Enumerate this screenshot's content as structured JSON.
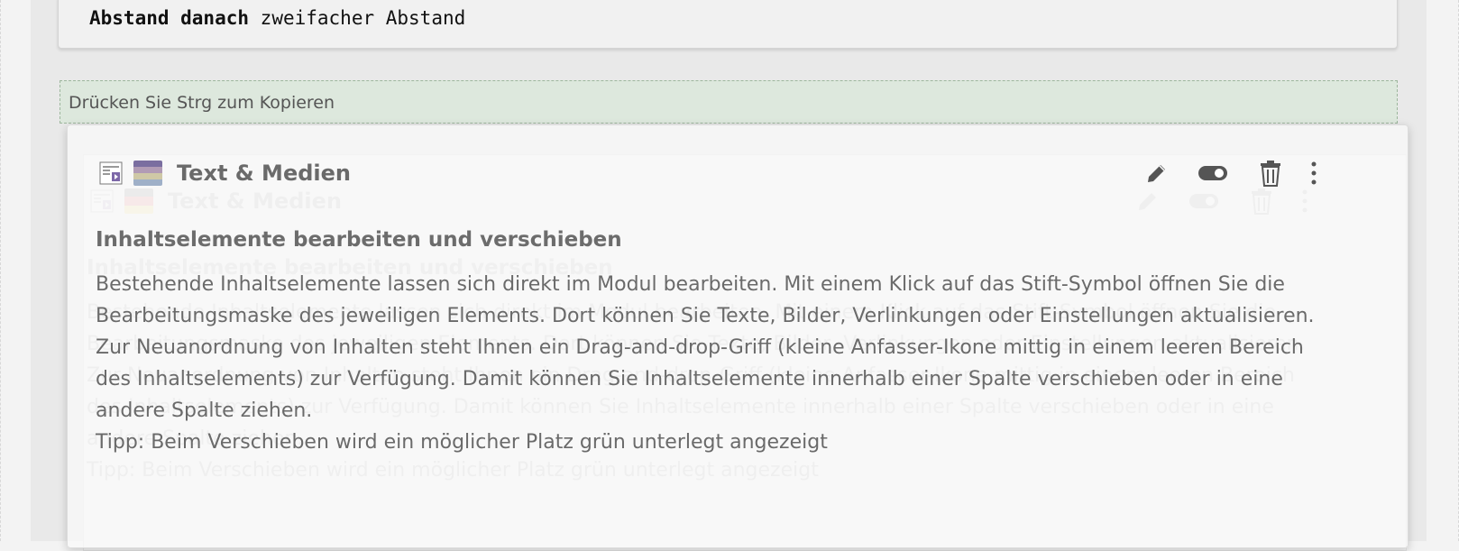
{
  "previous_element": {
    "label": "Abstand danach",
    "value": "zweifacher Abstand"
  },
  "dropzone": {
    "hint": "Drücken Sie Strg zum Kopieren"
  },
  "content_element": {
    "type_icon": "text-media-icon",
    "language_icon": "language-flag-icon",
    "title": "Text & Medien",
    "actions": [
      "pencil-icon",
      "toggle-icon",
      "trash-icon",
      "more-vertical-icon"
    ],
    "heading": "Inhaltselemente bearbeiten und verschieben",
    "paragraphs": [
      "Bestehende Inhaltselemente lassen sich direkt im Modul bearbeiten. Mit einem Klick auf das Stift-Symbol öffnen Sie die Bearbeitungsmaske des jeweiligen Elements. Dort können Sie Texte, Bilder, Verlinkungen oder Einstellungen aktualisieren.",
      "Zur Neuanordnung von Inhalten steht Ihnen ein Drag-and-drop-Griff (kleine Anfasser-Ikone mittig in einem leeren Bereich des Inhaltselements) zur Verfügung. Damit können Sie Inhaltselemente innerhalb einer Spalte verschieben oder in eine andere Spalte ziehen.",
      "Tipp: Beim Verschieben wird ein möglicher Platz grün unterlegt angezeigt"
    ]
  },
  "colors": {
    "dropzone_bg": "#dde8dd",
    "dropzone_border": "#9db69d",
    "text": "#5e5e5e"
  }
}
